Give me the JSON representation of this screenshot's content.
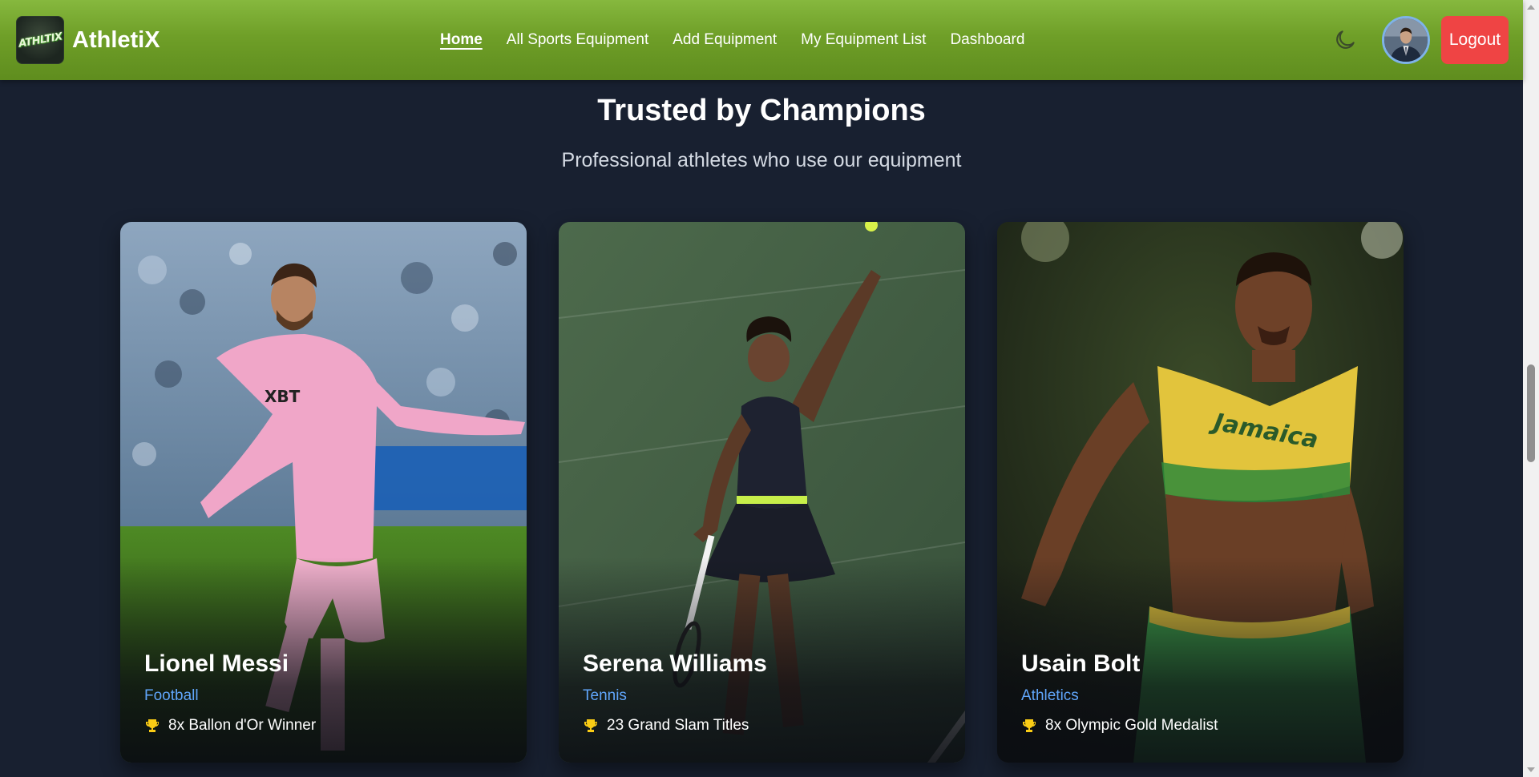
{
  "brand": {
    "logo_text": "ATHLTIX",
    "name": "AthletiX"
  },
  "nav": {
    "links": [
      {
        "label": "Home",
        "active": true
      },
      {
        "label": "All Sports Equipment",
        "active": false
      },
      {
        "label": "Add Equipment",
        "active": false
      },
      {
        "label": "My Equipment List",
        "active": false
      },
      {
        "label": "Dashboard",
        "active": false
      }
    ],
    "theme_icon": "moon-icon",
    "logout_label": "Logout"
  },
  "section": {
    "title": "Trusted by Champions",
    "subtitle": "Professional athletes who use our equipment"
  },
  "athletes": [
    {
      "name": "Lionel Messi",
      "sport": "Football",
      "achievement": "8x Ballon d'Or Winner",
      "icon": "trophy-icon"
    },
    {
      "name": "Serena Williams",
      "sport": "Tennis",
      "achievement": "23 Grand Slam Titles",
      "icon": "trophy-icon"
    },
    {
      "name": "Usain Bolt",
      "sport": "Athletics",
      "achievement": "8x Olympic Gold Medalist",
      "icon": "trophy-icon"
    }
  ],
  "colors": {
    "navbar": "#6f9f28",
    "page_background": "#182030",
    "logout": "#ef4444",
    "sport_label": "#60a5fa",
    "trophy": "#facc15"
  }
}
